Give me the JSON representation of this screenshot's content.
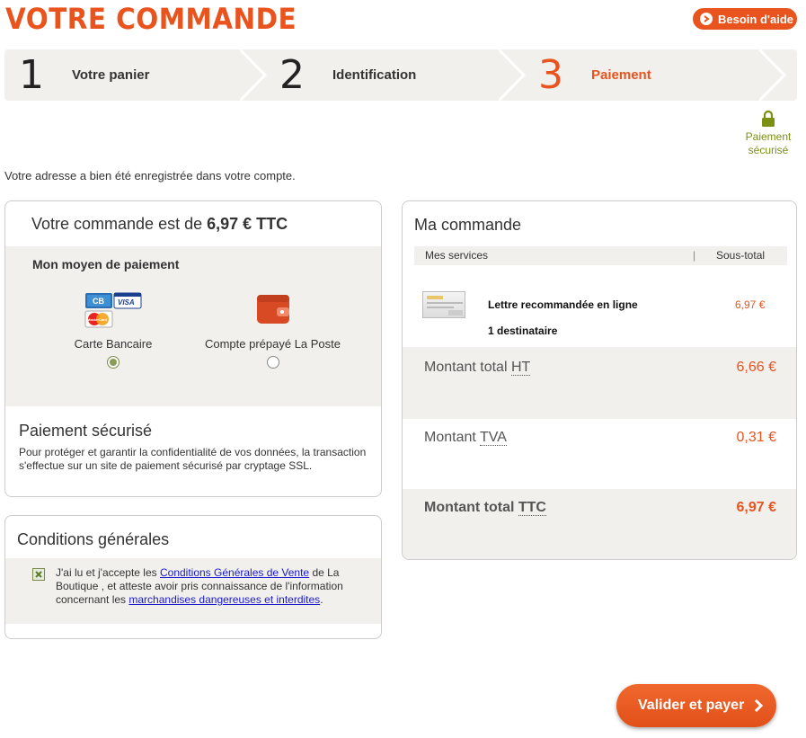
{
  "header": {
    "title": "VOTRE COMMANDE",
    "help_label": "Besoin d'aide",
    "accent": "#e9541e"
  },
  "steps": [
    {
      "num": "1",
      "label": "Votre panier",
      "active": false
    },
    {
      "num": "2",
      "label": "Identification",
      "active": false
    },
    {
      "num": "3",
      "label": "Paiement",
      "active": true
    }
  ],
  "secure_badge": {
    "line1": "Paiement",
    "line2": "sécurisé",
    "icon": "lock-icon"
  },
  "address_message": "Votre adresse a bien été enregistrée dans votre compte.",
  "payment": {
    "title_prefix": "Votre commande est de",
    "amount": "6,97 € TTC",
    "method_heading": "Mon moyen de paiement",
    "options": [
      {
        "label": "Carte Bancaire",
        "icon": "credit-cards-icon",
        "selected": true
      },
      {
        "label": "Compte prépayé La Poste",
        "icon": "wallet-icon",
        "selected": false
      }
    ],
    "card_logos": [
      "CB",
      "VISA",
      "MasterCard"
    ],
    "secure_title": "Paiement sécurisé",
    "secure_text": "Pour protéger et garantir la confidentialité de vos données, la transaction s'effectue sur un site de paiement sécurisé par cryptage SSL."
  },
  "conditions": {
    "title": "Conditions générales",
    "checked": true,
    "text_1": "J'ai lu et j'accepte les ",
    "link_1": "Conditions Générales de Vente",
    "text_2": " de La Boutique , et atteste avoir pris connaissance de l'information concernant les ",
    "link_2": "marchandises dangereuses et interdites",
    "text_3": "."
  },
  "order": {
    "title": "Ma commande",
    "col_services": "Mes services",
    "col_subtotal": "Sous-total",
    "separator": "|",
    "item_name": "Lettre recommandée en ligne",
    "item_recipients": "1 destinataire",
    "item_price": "6,97 €",
    "ht_label": "Montant total ",
    "ht_abbr": "HT",
    "ht_value": "6,66 €",
    "tva_label": "Montant ",
    "tva_abbr": "TVA",
    "tva_value": "0,31 €",
    "ttc_label": "Montant total ",
    "ttc_abbr": "TTC",
    "ttc_value": "6,97 €"
  },
  "validate_label": "Valider et payer"
}
